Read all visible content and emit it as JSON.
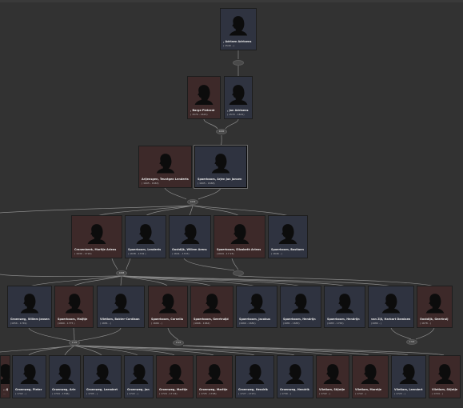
{
  "people": [
    {
      "id": "p0",
      "name": ", Adriaen Adriaens",
      "dates": "( 1540 - )",
      "gender": "m"
    },
    {
      "id": "p1",
      "name": ", Barge Pieterdr",
      "dates": "( 1570 - 1621)",
      "gender": "f"
    },
    {
      "id": "p2",
      "name": ", Jan Adriaens",
      "dates": "( 1570 - 1621)",
      "gender": "m"
    },
    {
      "id": "p3",
      "name": "Arijensgen, Teuntgen Lenderts",
      "dates": "( 1605 - 1663)",
      "gender": "f"
    },
    {
      "id": "p4",
      "name": "Spaerboom, Arjen Jan Jansen",
      "dates": "( 1605 - 1668)",
      "gender": "m"
    },
    {
      "id": "p5",
      "name": "Cranenbeek, Maritje Ariens",
      "dates": "( 1630 - 1724)",
      "gender": "f"
    },
    {
      "id": "p6",
      "name": "Spaerboom, Lenderts",
      "dates": "( 1638 - 1702 )",
      "gender": "m"
    },
    {
      "id": "p7",
      "name": "Oostdijk, Willem Arens",
      "dates": "( 1641 - 1707)",
      "gender": "m"
    },
    {
      "id": "p8",
      "name": "Spaerboom, Elizabeth Ariens",
      "dates": "(1644 - 17 23)",
      "gender": "f"
    },
    {
      "id": "p9",
      "name": "Spaerboom, Bastiaen",
      "dates": "( 1646 - )",
      "gender": "m"
    },
    {
      "id": "p10",
      "name": "Groenweg, Willem Jansen",
      "dates": "(1656 - 1749)",
      "gender": "m"
    },
    {
      "id": "p11",
      "name": "Spaerboom, Maijtje",
      "dates": "(1669 - 1775 )",
      "gender": "f"
    },
    {
      "id": "p12",
      "name": "Vlietlam, Bakter-Cordiaan",
      "dates": "( 1681 - )",
      "gender": "m"
    },
    {
      "id": "p13",
      "name": "Spaerboom, Cornelia",
      "dates": "( 1666 - )",
      "gender": "f"
    },
    {
      "id": "p14",
      "name": "Spaerboom, Geertruijd",
      "dates": "(1666 - 1662)",
      "gender": "f"
    },
    {
      "id": "p15",
      "name": "Spaerboom, Jacobus",
      "dates": "(1669 - 1681)",
      "gender": "m"
    },
    {
      "id": "p16",
      "name": "Spaerboom, Hendrijn",
      "dates": "(1681 - 1683)",
      "gender": "m"
    },
    {
      "id": "p17",
      "name": "Spaerboom, Hendrijn",
      "dates": "(1683 - 1763)",
      "gender": "m"
    },
    {
      "id": "p18",
      "name": "van Zijl, Harbart Damiaen",
      "dates": "(1680 - )",
      "gender": "m"
    },
    {
      "id": "p19",
      "name": "Oostdijk, Geertruij",
      "dates": "( 1678 - )",
      "gender": "f"
    },
    {
      "id": "p20",
      "name": "...ijtje",
      "dates": "...",
      "gender": "f"
    },
    {
      "id": "p21",
      "name": "Groenweg, Pieter",
      "dates": "( 1702 - )",
      "gender": "m"
    },
    {
      "id": "p22",
      "name": "Groenweg, Arie",
      "dates": "( 1704 - 1796)",
      "gender": "m"
    },
    {
      "id": "p23",
      "name": "Groenweg, Leendert",
      "dates": "( 1705 - )",
      "gender": "m"
    },
    {
      "id": "p24",
      "name": "Groenweg, Jan",
      "dates": "( 1722 - )",
      "gender": "m"
    },
    {
      "id": "p25",
      "name": "Groenweg, Maritje",
      "dates": "( 1724 - 17 24)",
      "gender": "f"
    },
    {
      "id": "p26",
      "name": "Groenweg, Maritje",
      "dates": "( 1725 - 1728)",
      "gender": "f"
    },
    {
      "id": "p27",
      "name": "Groenweg, Hendrik",
      "dates": "( 1727 - 1727)",
      "gender": "m"
    },
    {
      "id": "p28",
      "name": "Groenweg, Hendrik",
      "dates": "( 1730 - )",
      "gender": "m"
    },
    {
      "id": "p29",
      "name": "Vlietlam, Stijntje",
      "dates": "( 1722 - )",
      "gender": "f"
    },
    {
      "id": "p30",
      "name": "Vlietlam, Maretje",
      "dates": "( 1722 - )",
      "gender": "f"
    },
    {
      "id": "p31",
      "name": "Vlietlam, Leendert",
      "dates": "( 1723 - )",
      "gender": "m"
    },
    {
      "id": "p32",
      "name": "Vlietlam, Stijntje",
      "dates": "( 1724 - )",
      "gender": "f"
    }
  ],
  "unions": [
    {
      "id": "u0",
      "label": ""
    },
    {
      "id": "u1",
      "label": "1600"
    },
    {
      "id": "u2",
      "label": "1629"
    },
    {
      "id": "u3",
      "label": "1688"
    },
    {
      "id": "u4",
      "label": ""
    },
    {
      "id": "u5",
      "label": "1720"
    },
    {
      "id": "u6",
      "label": "1722"
    },
    {
      "id": "u7",
      "label": "1720"
    }
  ],
  "selected_person": "p4"
}
